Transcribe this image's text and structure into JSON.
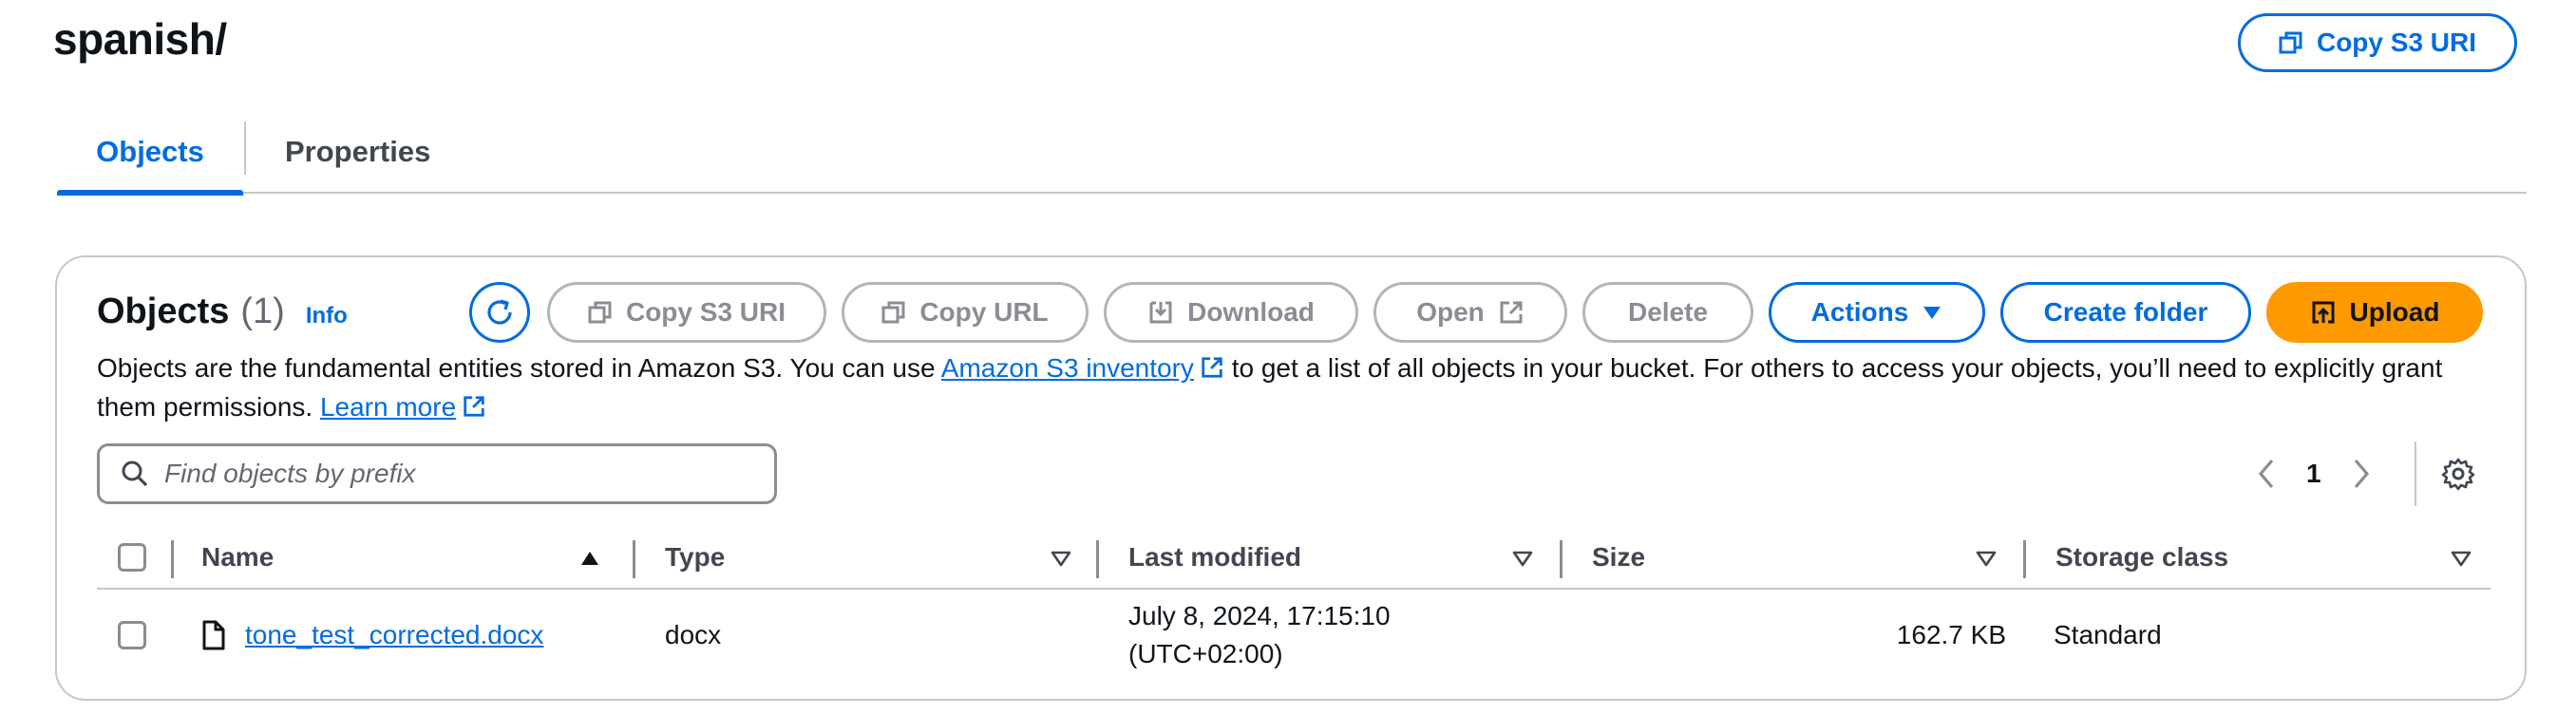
{
  "header": {
    "title": "spanish/",
    "copy_s3_uri_label": "Copy S3 URI"
  },
  "tabs": [
    {
      "label": "Objects",
      "active": true
    },
    {
      "label": "Properties",
      "active": false
    }
  ],
  "objects_panel": {
    "title": "Objects",
    "count": "(1)",
    "info_label": "Info",
    "toolbar": {
      "copy_s3_uri": "Copy S3 URI",
      "copy_url": "Copy URL",
      "download": "Download",
      "open": "Open",
      "delete": "Delete",
      "actions": "Actions",
      "create_folder": "Create folder",
      "upload": "Upload"
    },
    "description": {
      "part1": "Objects are the fundamental entities stored in Amazon S3. You can use ",
      "link1": "Amazon S3 inventory",
      "part2": " to get a list of all objects in your bucket. For others to access your objects, you’ll need to explicitly grant them permissions. ",
      "link2": "Learn more"
    },
    "search": {
      "placeholder": "Find objects by prefix",
      "value": ""
    },
    "pagination": {
      "current_page": "1"
    },
    "table": {
      "columns": [
        "Name",
        "Type",
        "Last modified",
        "Size",
        "Storage class"
      ],
      "rows": [
        {
          "name": "tone_test_corrected.docx",
          "type": "docx",
          "last_modified_line1": "July 8, 2024, 17:15:10",
          "last_modified_line2": "(UTC+02:00)",
          "size": "162.7 KB",
          "storage_class": "Standard"
        }
      ]
    }
  },
  "colors": {
    "accent": "#006ce0",
    "upload": "#ff9900",
    "disabled": "#8c8c94",
    "border": "#c6c6cd"
  }
}
